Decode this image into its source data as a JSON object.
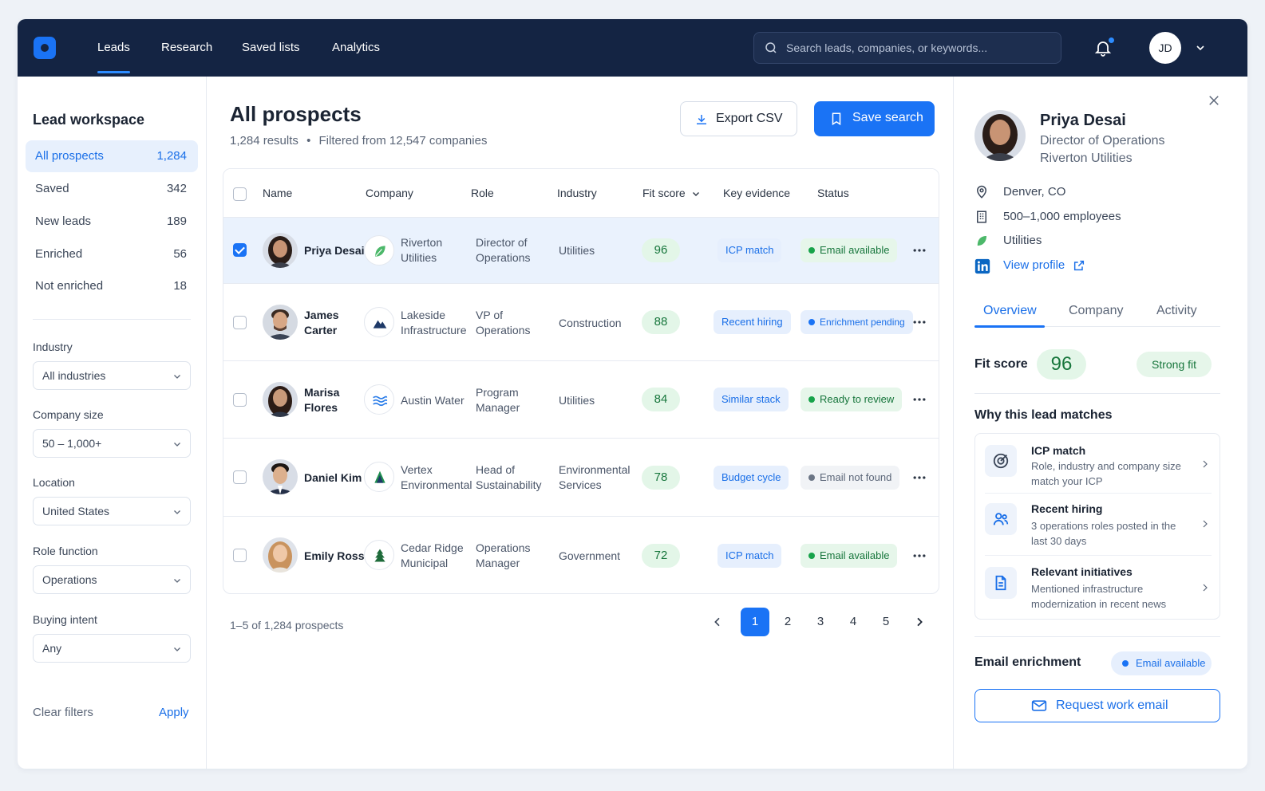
{
  "nav": {
    "links": [
      "Leads",
      "Research",
      "Saved lists",
      "Analytics"
    ],
    "active": "Leads",
    "search_placeholder": "Search leads, companies, or keywords...",
    "user_initials": "JD"
  },
  "sidebar": {
    "title": "Lead workspace",
    "items": [
      {
        "label": "All prospects",
        "count": "1,284"
      },
      {
        "label": "Saved",
        "count": "342"
      },
      {
        "label": "New leads",
        "count": "189"
      },
      {
        "label": "Enriched",
        "count": "56"
      },
      {
        "label": "Not enriched",
        "count": "18"
      }
    ],
    "filters": [
      {
        "label": "Industry",
        "value": "All industries"
      },
      {
        "label": "Company size",
        "value": "50 – 1,000+"
      },
      {
        "label": "Location",
        "value": "United States"
      },
      {
        "label": "Role function",
        "value": "Operations"
      },
      {
        "label": "Buying intent",
        "value": "Any"
      }
    ],
    "clear_label": "Clear filters",
    "apply_label": "Apply"
  },
  "main": {
    "title": "All prospects",
    "results": "1,284 results",
    "bullet": "•",
    "filtered": "Filtered from 12,547 companies",
    "export_label": "Export CSV",
    "save_label": "Save search",
    "columns": [
      "Name",
      "Company",
      "Role",
      "Industry",
      "Fit score",
      "Key evidence",
      "Status"
    ],
    "rows": [
      {
        "name": "Priya Desai",
        "company": "Riverton Utilities",
        "role": "Director of Operations",
        "industry": "Utilities",
        "fit": "96",
        "evidence": "ICP match",
        "status": "Email available",
        "status_kind": "green",
        "selected": true
      },
      {
        "name": "James Carter",
        "company": "Lakeside Infrastructure",
        "role": "VP of Operations",
        "industry": "Construction",
        "fit": "88",
        "evidence": "Recent hiring",
        "status": "Enrichment pending",
        "status_kind": "blue",
        "selected": false
      },
      {
        "name": "Marisa Flores",
        "company": "Austin Water",
        "role": "Program Manager",
        "industry": "Utilities",
        "fit": "84",
        "evidence": "Similar stack",
        "status": "Ready to review",
        "status_kind": "green",
        "selected": false
      },
      {
        "name": "Daniel Kim",
        "company": "Vertex Environmental",
        "role": "Head of Sustainability",
        "industry": "Environmental Services",
        "fit": "78",
        "evidence": "Budget cycle",
        "status": "Email not found",
        "status_kind": "gray",
        "selected": false
      },
      {
        "name": "Emily Ross",
        "company": "Cedar Ridge Municipal",
        "role": "Operations Manager",
        "industry": "Government",
        "fit": "72",
        "evidence": "ICP match",
        "status": "Email available",
        "status_kind": "green",
        "selected": false
      }
    ],
    "pager_info": "1–5 of 1,284 prospects",
    "pages": [
      "1",
      "2",
      "3",
      "4",
      "5"
    ],
    "current_page": "1"
  },
  "panel": {
    "name": "Priya Desai",
    "title": "Director of Operations",
    "company": "Riverton Utilities",
    "location": "Denver, CO",
    "employees": "500–1,000 employees",
    "industry": "Utilities",
    "profile_link": "View profile",
    "tabs": [
      "Overview",
      "Company",
      "Activity"
    ],
    "fit_label": "Fit score",
    "fit_value": "96",
    "fit_badge": "Strong fit",
    "why_title": "Why this lead matches",
    "matches": [
      {
        "title": "ICP match",
        "desc": "Role, industry and company size match your ICP"
      },
      {
        "title": "Recent hiring",
        "desc": "3 operations roles posted in the last 30 days"
      },
      {
        "title": "Relevant initiatives",
        "desc": "Mentioned infrastructure modernization in recent news"
      }
    ],
    "enrichment_title": "Email enrichment",
    "enrichment_status": "Email available",
    "request_label": "Request work email"
  },
  "colors": {
    "nav_bg": "#142443",
    "accent": "#1a73f5",
    "fit_green": "#17763c",
    "selected_row": "#eaf2fd"
  },
  "icons": {
    "search": "search-icon",
    "bell": "bell-icon",
    "chevron": "chevron-down-icon",
    "download": "download-icon",
    "bookmark": "bookmark-icon",
    "more": "more-icon",
    "close": "close-icon",
    "location": "location-pin-icon",
    "building": "building-icon",
    "leaf": "leaf-icon",
    "linkedin": "linkedin-icon",
    "external": "external-link-icon",
    "target": "target-icon",
    "users": "users-icon",
    "document": "document-icon",
    "mail": "mail-icon"
  }
}
